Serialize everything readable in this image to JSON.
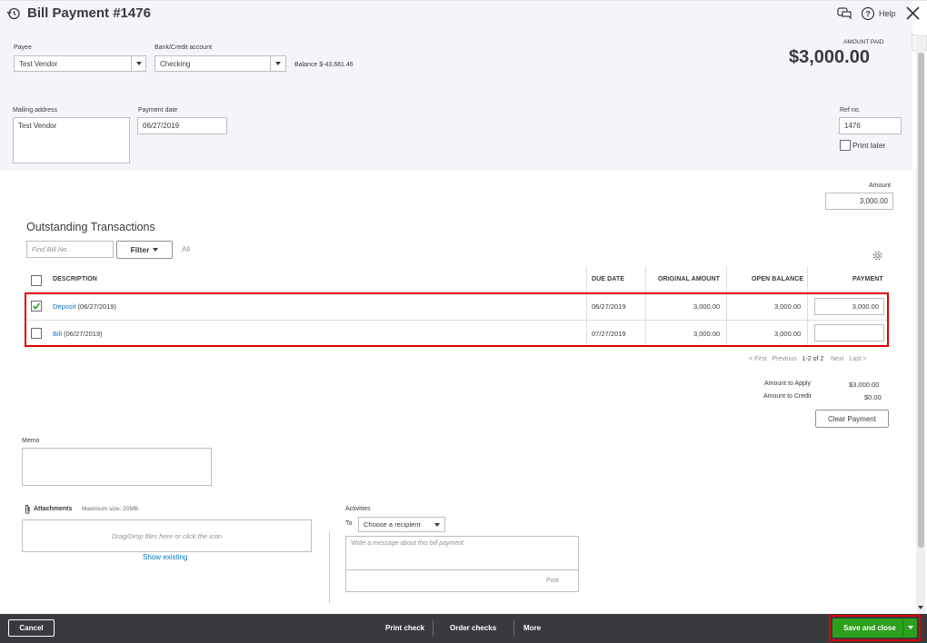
{
  "header": {
    "title": "Bill Payment #1476",
    "help_label": "Help",
    "amount_paid_label": "AMOUNT PAID",
    "amount_paid_value": "$3,000.00"
  },
  "form": {
    "payee_label": "Payee",
    "payee_value": "Test Vendor",
    "bank_label": "Bank/Credit account",
    "bank_value": "Checking",
    "balance_text": "Balance $-43,681.46",
    "mailing_label": "Mailing address",
    "mailing_value": "Test Vendor",
    "payment_date_label": "Payment date",
    "payment_date_value": "06/27/2019",
    "ref_label": "Ref no.",
    "ref_value": "1476",
    "print_later_label": "Print later",
    "amount_label": "Amount",
    "amount_value": "3,000.00"
  },
  "transactions": {
    "section_title": "Outstanding Transactions",
    "find_placeholder": "Find Bill No.",
    "filter_label": "Filter",
    "all_label": "All",
    "columns": [
      "DESCRIPTION",
      "DUE DATE",
      "ORIGINAL AMOUNT",
      "OPEN BALANCE",
      "PAYMENT"
    ],
    "rows": [
      {
        "checked": true,
        "link": "Deposit",
        "desc_rest": " (06/27/2019)",
        "due_date": "06/27/2019",
        "original": "3,000.00",
        "open": "3,000.00",
        "payment": "3,000.00"
      },
      {
        "checked": false,
        "link": "Bill",
        "desc_rest": " (06/27/2019)",
        "due_date": "07/27/2019",
        "original": "3,000.00",
        "open": "3,000.00",
        "payment": ""
      }
    ],
    "pagination": {
      "first": "< First",
      "previous": "Previous",
      "range": "1-2 of 2",
      "next": "Next",
      "last": "Last >"
    },
    "amount_to_apply_label": "Amount to Apply",
    "amount_to_apply_value": "$3,000.00",
    "amount_to_credit_label": "Amount to Credit",
    "amount_to_credit_value": "$0.00",
    "clear_payment_label": "Clear Payment"
  },
  "memo": {
    "label": "Memo"
  },
  "attachments": {
    "label": "Attachments",
    "max_size": "Maximum size: 20MB",
    "drop_text": "Drag/Drop files here or click the icon",
    "show_existing": "Show existing"
  },
  "activities": {
    "label": "Activities",
    "to_label": "To",
    "recipient_value": "Choose a recipient",
    "message_placeholder": "Write a message about this bill payment",
    "post_label": "Post"
  },
  "footer": {
    "cancel": "Cancel",
    "print_check": "Print check",
    "order_checks": "Order checks",
    "more": "More",
    "save_and_close": "Save and close"
  },
  "colors": {
    "accent_green": "#2ca01c",
    "link_blue": "#0077c5",
    "highlight_red": "#e00000",
    "footer_dark": "#393a3d"
  }
}
